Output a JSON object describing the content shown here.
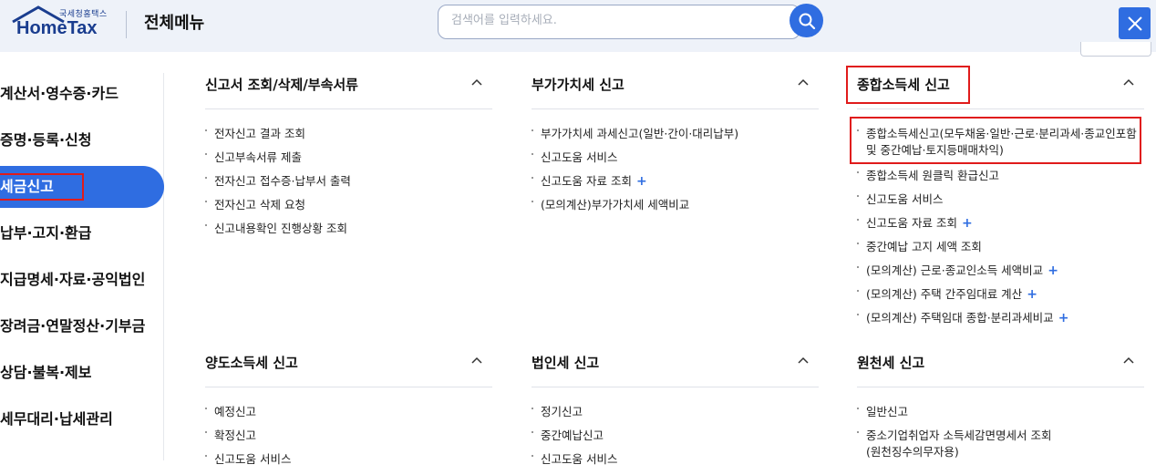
{
  "header": {
    "logo_small": "국세청홈택스",
    "logo_main": "HomeTax",
    "menu_title": "전체메뉴",
    "search_placeholder": "검색어를 입력하세요."
  },
  "sidebar": {
    "items": [
      {
        "label": "계산서·영수증·카드"
      },
      {
        "label": "증명·등록·신청"
      },
      {
        "label": "세금신고"
      },
      {
        "label": "납부·고지·환급"
      },
      {
        "label": "지급명세·자료·공익법인"
      },
      {
        "label": "장려금·연말정산·기부금"
      },
      {
        "label": "상담·불복·제보"
      },
      {
        "label": "세무대리·납세관리"
      }
    ]
  },
  "sections": [
    {
      "title": "신고서 조회/삭제/부속서류",
      "items": [
        "전자신고 결과 조회",
        "신고부속서류 제출",
        "전자신고 접수증·납부서 출력",
        "전자신고 삭제 요청",
        "신고내용확인 진행상황 조회"
      ]
    },
    {
      "title": "부가가치세 신고",
      "items": [
        "부가가치세 과세신고(일반·간이·대리납부)",
        "신고도움 서비스",
        "신고도움 자료 조회",
        "(모의계산)부가가치세 세액비교"
      ]
    },
    {
      "title": "종합소득세 신고",
      "items": [
        "종합소득세신고(모두채움·일반·근로·분리과세·종교인포함",
        "및 중간예납·토지등매매차익)",
        "종합소득세 원클릭 환급신고",
        "신고도움 서비스",
        "신고도움 자료 조회",
        "중간예납 고지 세액 조회",
        "(모의계산) 근로·종교인소득 세액비교",
        "(모의계산) 주택 간주임대료 계산",
        "(모의계산) 주택임대 종합·분리과세비교"
      ]
    },
    {
      "title": "양도소득세 신고",
      "items": [
        "예정신고",
        "확정신고",
        "신고도움 서비스"
      ]
    },
    {
      "title": "법인세 신고",
      "items": [
        "정기신고",
        "중간예납신고",
        "신고도움 서비스"
      ]
    },
    {
      "title": "원천세 신고",
      "items": [
        "일반신고",
        "중소기업취업자 소득세감면명세서 조회",
        "(원천징수의무자용)"
      ]
    }
  ],
  "plus_symbol": "+"
}
